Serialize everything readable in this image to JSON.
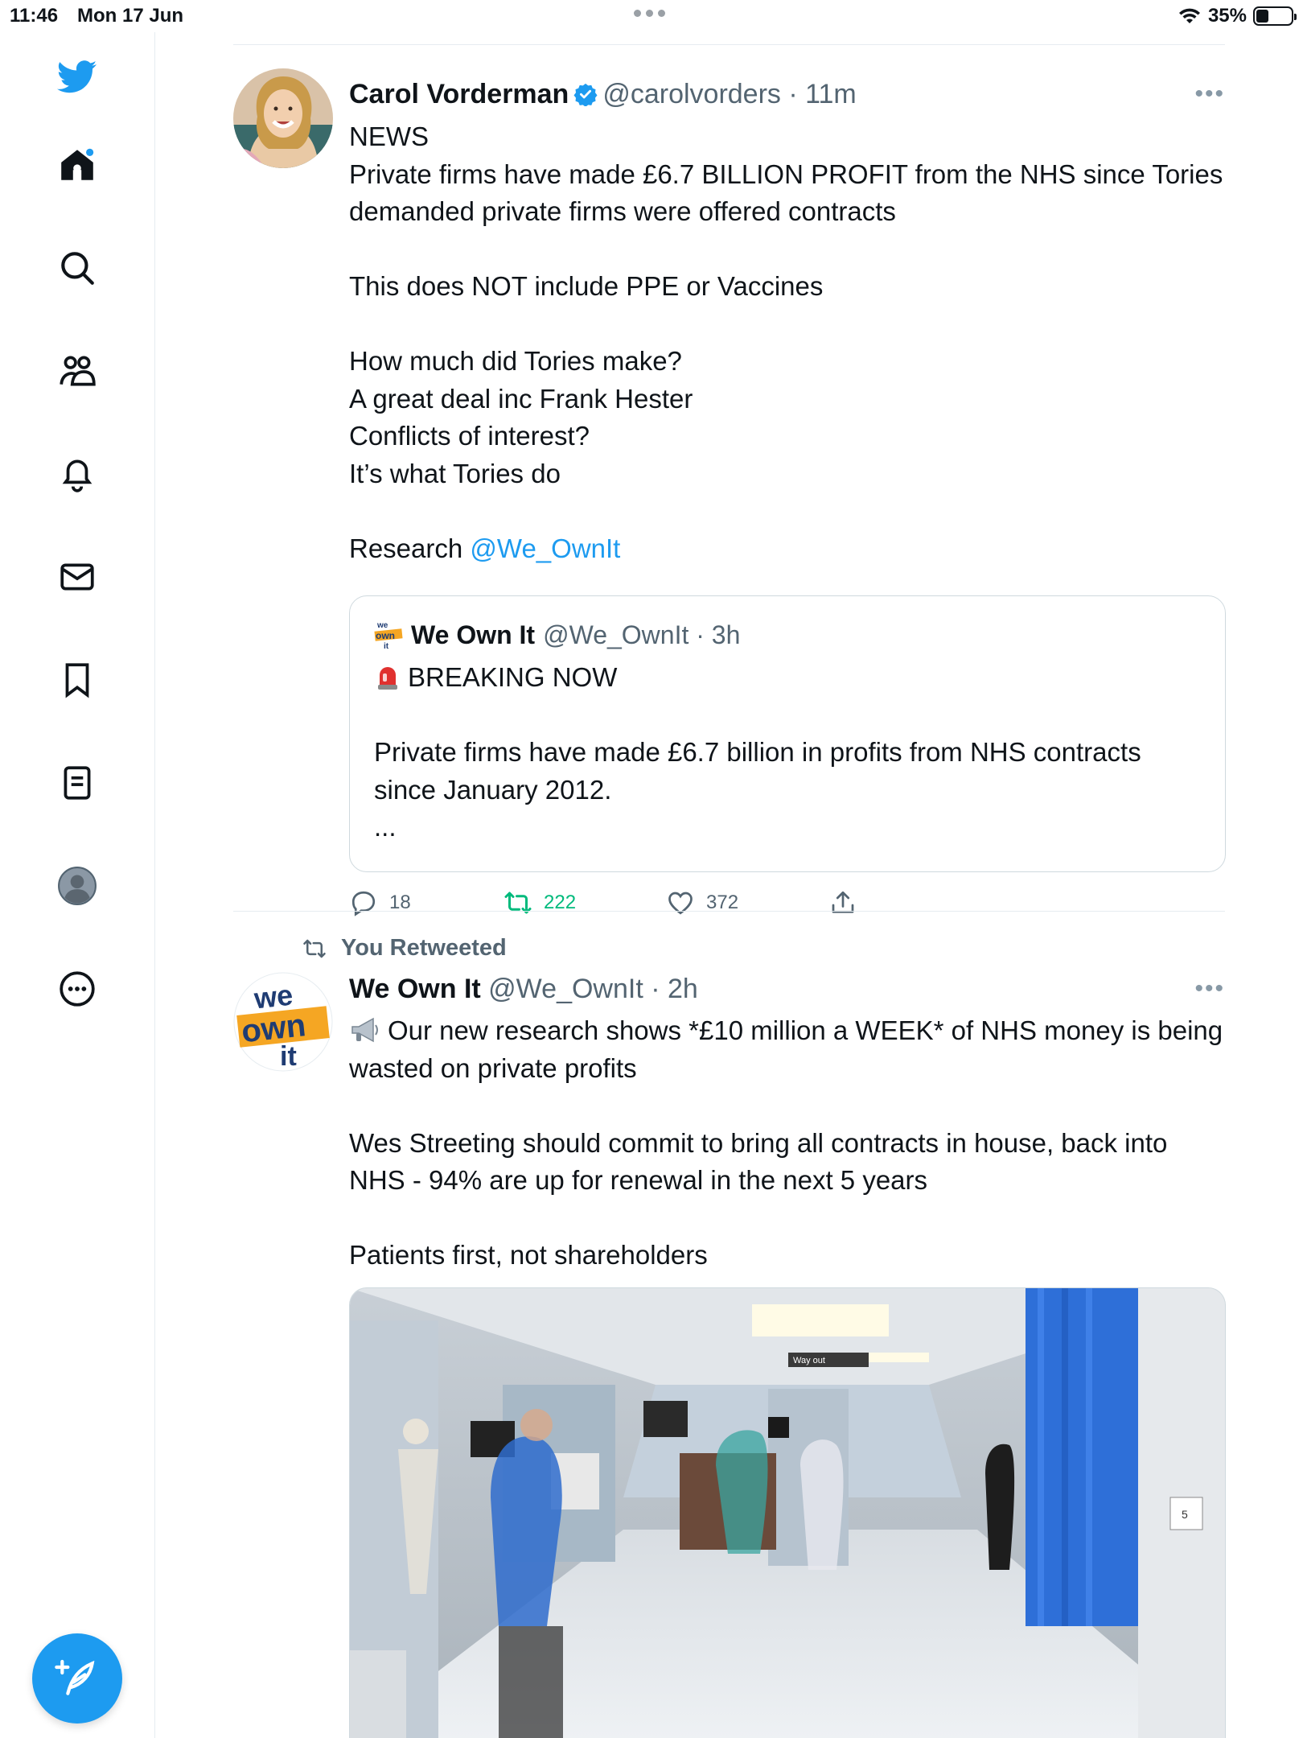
{
  "status_bar": {
    "time": "11:46",
    "date": "Mon 17 Jun",
    "battery": "35%",
    "battery_level": 0.35
  },
  "sidebar": {
    "items": [
      {
        "icon": "twitter-logo-icon"
      },
      {
        "icon": "home-icon",
        "has_notification_dot": true
      },
      {
        "icon": "search-icon"
      },
      {
        "icon": "communities-icon"
      },
      {
        "icon": "notifications-bell-icon"
      },
      {
        "icon": "messages-envelope-icon"
      },
      {
        "icon": "bookmark-icon"
      },
      {
        "icon": "lists-icon"
      },
      {
        "icon": "profile-avatar-icon"
      },
      {
        "icon": "more-options-icon"
      }
    ],
    "compose_icon": "compose-tweet-icon"
  },
  "colors": {
    "accent": "#1d9bf0",
    "text": "#0f1419",
    "secondary": "#536471",
    "retweet_active": "#00ba7c",
    "border": "#cfd9de"
  },
  "tweets": [
    {
      "name": "Carol Vorderman",
      "verified": true,
      "handle": "@carolvorders",
      "time": "11m",
      "text_main": "NEWS\nPrivate firms have made £6.7 BILLION PROFIT from the NHS since Tories demanded private firms were offered contracts\n\nThis does NOT include PPE or Vaccines\n\nHow much did Tories make?\nA great deal inc Frank Hester\nConflicts of interest?\nIt’s what Tories do\n\nResearch ",
      "mention": "@We_OwnIt",
      "quote": {
        "name": "We Own It",
        "handle": "@We_OwnIt",
        "time": "3h",
        "headline": "BREAKING NOW",
        "text": "Private firms have made £6.7 billion in profits from NHS contracts since January 2012.\n..."
      },
      "actions": {
        "replies": "18",
        "retweets": "222",
        "likes": "372"
      }
    },
    {
      "retweeted_label": "You Retweeted",
      "name": "We Own It",
      "handle": "@We_OwnIt",
      "time": "2h",
      "text": "Our new research shows *£10 million a WEEK* of NHS money is being wasted on private profits\n\nWes Streeting should commit to bring all contracts in house, back into NHS - 94% are up for renewal in the next 5 years\n\nPatients first, not shareholders",
      "media_sign": "Way out",
      "media_room_number": "5"
    }
  ]
}
